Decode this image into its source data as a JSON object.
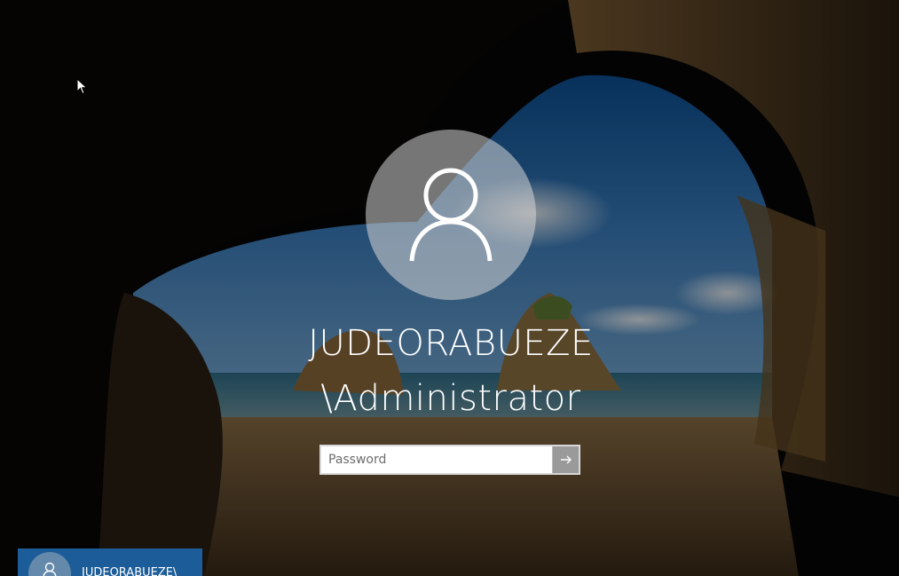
{
  "login": {
    "username_line1": "JUDEORABUEZE",
    "username_line2": "\\Administrator",
    "password_placeholder": "Password"
  },
  "user_tile": {
    "label": "JUDEORABUEZE\\"
  },
  "icons": {
    "avatar": "user-icon",
    "submit": "arrow-right-icon",
    "cursor": "mouse-pointer-icon"
  },
  "colors": {
    "tile_background": "#1c5d99",
    "avatar_circle": "#d6d6d6",
    "text": "#ffffff"
  }
}
